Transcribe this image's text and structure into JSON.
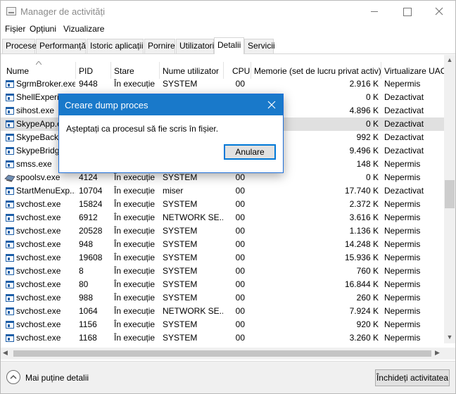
{
  "window": {
    "title": "Manager de activități",
    "controls": {
      "minimize": "minimize",
      "maximize": "maximize",
      "close": "close"
    }
  },
  "menu": [
    "Fișier",
    "Opțiuni",
    "Vizualizare"
  ],
  "tabs": [
    "Procese",
    "Performanță",
    "Istoric aplicații",
    "Pornire",
    "Utilizatori",
    "Detalii",
    "Servicii"
  ],
  "active_tab": "Detalii",
  "columns": {
    "name": "Nume",
    "pid": "PID",
    "status": "Stare",
    "user": "Nume utilizator",
    "cpu": "CPU",
    "memory": "Memorie (set de lucru privat activ)",
    "uac": "Virtualizare UAC"
  },
  "rows": [
    {
      "name": "SgrmBroker.exe",
      "pid": "9448",
      "status": "În execuție",
      "user": "SYSTEM",
      "cpu": "00",
      "memory": "2.916 K",
      "uac": "Nepermis",
      "icon": "app-icon"
    },
    {
      "name": "ShellExperie",
      "pid": "",
      "status": "",
      "user": "",
      "cpu": "",
      "memory": "0 K",
      "uac": "Dezactivat",
      "icon": "app-icon"
    },
    {
      "name": "sihost.exe",
      "pid": "",
      "status": "",
      "user": "",
      "cpu": "",
      "memory": "4.896 K",
      "uac": "Dezactivat",
      "icon": "app-icon"
    },
    {
      "name": "SkypeApp.e",
      "pid": "",
      "status": "",
      "user": "",
      "cpu": "",
      "memory": "0 K",
      "uac": "Dezactivat",
      "icon": "app-icon",
      "selected": true
    },
    {
      "name": "SkypeBackg",
      "pid": "",
      "status": "",
      "user": "",
      "cpu": "",
      "memory": "992 K",
      "uac": "Dezactivat",
      "icon": "app-icon"
    },
    {
      "name": "SkypeBridg",
      "pid": "",
      "status": "",
      "user": "",
      "cpu": "",
      "memory": "9.496 K",
      "uac": "Dezactivat",
      "icon": "app-icon"
    },
    {
      "name": "smss.exe",
      "pid": "",
      "status": "",
      "user": "",
      "cpu": "",
      "memory": "148 K",
      "uac": "Nepermis",
      "icon": "app-icon"
    },
    {
      "name": "spoolsv.exe",
      "pid": "4124",
      "status": "În execuție",
      "user": "SYSTEM",
      "cpu": "00",
      "memory": "0 K",
      "uac": "Nepermis",
      "icon": "printer-icon"
    },
    {
      "name": "StartMenuExp...",
      "pid": "10704",
      "status": "În execuție",
      "user": "miser",
      "cpu": "00",
      "memory": "17.740 K",
      "uac": "Dezactivat",
      "icon": "app-icon"
    },
    {
      "name": "svchost.exe",
      "pid": "15824",
      "status": "În execuție",
      "user": "SYSTEM",
      "cpu": "00",
      "memory": "2.372 K",
      "uac": "Nepermis",
      "icon": "app-icon"
    },
    {
      "name": "svchost.exe",
      "pid": "6912",
      "status": "În execuție",
      "user": "NETWORK SE...",
      "cpu": "00",
      "memory": "3.616 K",
      "uac": "Nepermis",
      "icon": "app-icon"
    },
    {
      "name": "svchost.exe",
      "pid": "20528",
      "status": "În execuție",
      "user": "SYSTEM",
      "cpu": "00",
      "memory": "1.136 K",
      "uac": "Nepermis",
      "icon": "app-icon"
    },
    {
      "name": "svchost.exe",
      "pid": "948",
      "status": "În execuție",
      "user": "SYSTEM",
      "cpu": "00",
      "memory": "14.248 K",
      "uac": "Nepermis",
      "icon": "app-icon"
    },
    {
      "name": "svchost.exe",
      "pid": "19608",
      "status": "În execuție",
      "user": "SYSTEM",
      "cpu": "00",
      "memory": "15.936 K",
      "uac": "Nepermis",
      "icon": "app-icon"
    },
    {
      "name": "svchost.exe",
      "pid": "8",
      "status": "În execuție",
      "user": "SYSTEM",
      "cpu": "00",
      "memory": "760 K",
      "uac": "Nepermis",
      "icon": "app-icon"
    },
    {
      "name": "svchost.exe",
      "pid": "80",
      "status": "În execuție",
      "user": "SYSTEM",
      "cpu": "00",
      "memory": "16.844 K",
      "uac": "Nepermis",
      "icon": "app-icon"
    },
    {
      "name": "svchost.exe",
      "pid": "988",
      "status": "În execuție",
      "user": "SYSTEM",
      "cpu": "00",
      "memory": "260 K",
      "uac": "Nepermis",
      "icon": "app-icon"
    },
    {
      "name": "svchost.exe",
      "pid": "1064",
      "status": "În execuție",
      "user": "NETWORK SE...",
      "cpu": "00",
      "memory": "7.924 K",
      "uac": "Nepermis",
      "icon": "app-icon"
    },
    {
      "name": "svchost.exe",
      "pid": "1156",
      "status": "În execuție",
      "user": "SYSTEM",
      "cpu": "00",
      "memory": "920 K",
      "uac": "Nepermis",
      "icon": "app-icon"
    },
    {
      "name": "svchost.exe",
      "pid": "1168",
      "status": "În execuție",
      "user": "SYSTEM",
      "cpu": "00",
      "memory": "3.260 K",
      "uac": "Nepermis",
      "icon": "app-icon"
    }
  ],
  "footer": {
    "fewer_details": "Mai puține detalii",
    "end_task": "Închideți activitatea"
  },
  "dialog": {
    "title": "Creare dump proces",
    "message": "Așteptați ca procesul să fie scris în fișier.",
    "cancel": "Anulare"
  },
  "colors": {
    "accent": "#1979ca",
    "selected_row": "#e0e0e0",
    "title_text": "#8a8a8a"
  }
}
